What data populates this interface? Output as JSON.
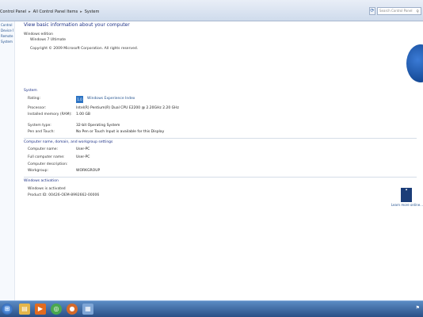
{
  "address_bar": {
    "crumbs": [
      "Control Panel",
      "All Control Panel Items",
      "System"
    ],
    "search_placeholder": "Search Control Panel"
  },
  "sidebar": {
    "items": [
      "Control Panel Home",
      "Device Manager",
      "Remote settings",
      "System protection"
    ]
  },
  "main": {
    "title": "View basic information about your computer",
    "edition_header": "Windows edition",
    "edition_name": "Windows 7 Ultimate",
    "copyright": "Copyright © 2009 Microsoft Corporation. All rights reserved.",
    "system_header": "System",
    "rows": [
      {
        "label": "Rating:",
        "value": "Windows Experience Index"
      },
      {
        "label": "Processor:",
        "value": "Intel(R) Pentium(R) Dual CPU E2200 @ 2.20GHz 2.20 GHz"
      },
      {
        "label": "Installed memory (RAM):",
        "value": "1.00 GB"
      },
      {
        "label": "System type:",
        "value": "32-bit Operating System"
      },
      {
        "label": "Pen and Touch:",
        "value": "No Pen or Touch Input is available for this Display"
      }
    ],
    "computer_header": "Computer name, domain, and workgroup settings",
    "computer_rows": [
      {
        "label": "Computer name:",
        "value": "User-PC"
      },
      {
        "label": "Full computer name:",
        "value": "User-PC"
      },
      {
        "label": "Computer description:",
        "value": ""
      },
      {
        "label": "Workgroup:",
        "value": "WORKGROUP"
      }
    ],
    "activation_header": "Windows activation",
    "activation_status": "Windows is activated",
    "product_id": "Product ID: 00426-OEM-8992662-00006",
    "genuine_link": "Learn more online...",
    "wei_score": "1.0"
  },
  "taskbar": {
    "apps": [
      "start-orb",
      "explorer",
      "media-player",
      "chrome",
      "firefox",
      "control-panel"
    ]
  },
  "colors": {
    "accent": "#1e3287",
    "taskbar": "#2a4f86"
  }
}
